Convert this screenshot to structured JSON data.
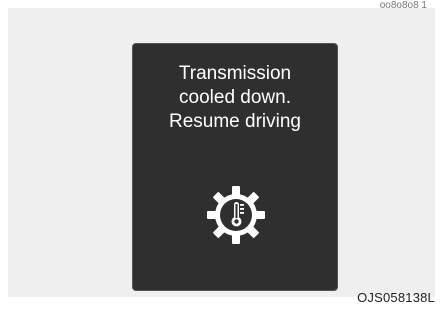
{
  "display": {
    "message_lines": [
      "Transmission",
      "cooled down.",
      "Resume driving"
    ],
    "icon": "transmission-temperature-gear-icon"
  },
  "figure": {
    "code": "OJS058138L",
    "top_code_partial": "oo8o8o8 1"
  },
  "colors": {
    "screen_bg": "#2f2f2f",
    "text": "#ffffff",
    "panel_bg": "#efefef"
  }
}
